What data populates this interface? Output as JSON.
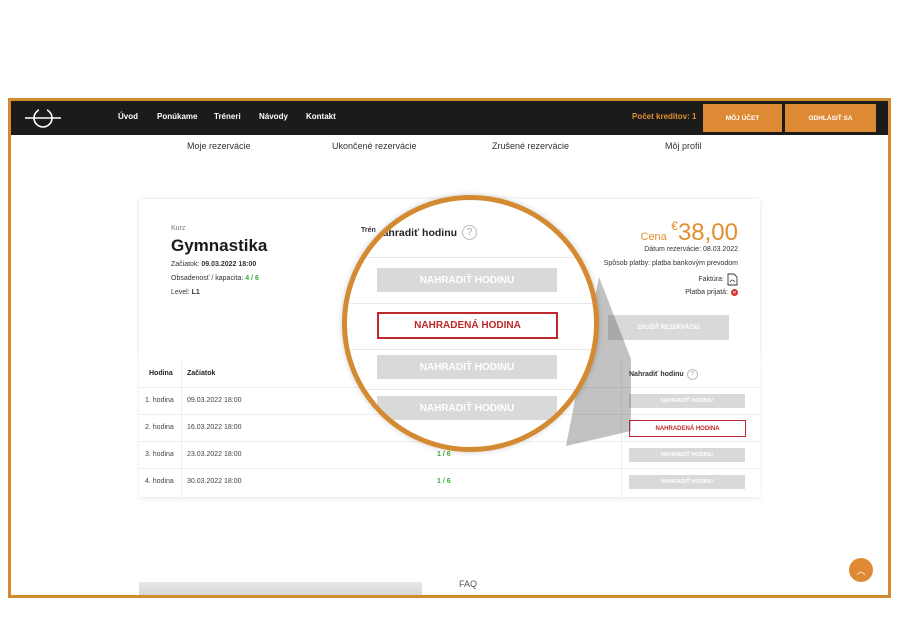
{
  "navbar": {
    "links": [
      "Úvod",
      "Ponúkame",
      "Tréneri",
      "Návody",
      "Kontakt"
    ],
    "credits": "Počet kreditov: 1",
    "account_btn": "MÔJ ÚČET",
    "logout_btn": "ODHLÁSIŤ SA"
  },
  "subnav": [
    "Moje rezervácie",
    "Ukončené rezervácie",
    "Zrušené rezervácie",
    "Môj profil"
  ],
  "course": {
    "label": "Kurz",
    "name": "Gymnastika",
    "start_label": "Začiatok:",
    "start_value": "09.03.2022 18:00",
    "occupancy_label": "Obsadenosť / kapacita:",
    "occupancy_value": "4 / 6",
    "level_label": "Level:",
    "level_value": "L1",
    "trainer_label_partial": "Trén"
  },
  "price": {
    "label": "Cena",
    "currency": "€",
    "value": "38,00",
    "reservation_date": "Dátum rezervácie: 08.03.2022",
    "payment_method": "Spôsob platby: platba bankovým prevodom",
    "invoice": "Faktúra:",
    "payment_received": "Platba prijatá:",
    "cancel_btn": "ZRUŠIŤ REZERVÁCIU"
  },
  "table": {
    "headers": [
      "Hodina",
      "Začiatok",
      "Nahradiť hodinu"
    ],
    "rows": [
      {
        "hour": "1. hodina",
        "start": "09.03.2022 18:00",
        "occ": "",
        "action": "NAHRADIŤ HODINU",
        "replaced": false
      },
      {
        "hour": "2. hodina",
        "start": "16.03.2022 18:00",
        "occ": "",
        "action": "NAHRADENÁ HODINA",
        "replaced": true
      },
      {
        "hour": "3. hodina",
        "start": "23.03.2022 18:00",
        "occ": "1 / 6",
        "action": "NAHRADIŤ HODINU",
        "replaced": false
      },
      {
        "hour": "4. hodina",
        "start": "30.03.2022 18:00",
        "occ": "1 / 6",
        "action": "NAHRADIŤ HODINU",
        "replaced": false
      }
    ]
  },
  "magnifier": {
    "header": "Nahradiť hodinu",
    "buttons": [
      "NAHRADIŤ HODINU",
      "NAHRADENÁ HODINA",
      "NAHRADIŤ HODINU",
      "NAHRADIŤ HODINU"
    ]
  },
  "footer": {
    "faq": "FAQ"
  },
  "colors": {
    "accent": "#de8a35",
    "navbar": "#1b1b1b",
    "green": "#3aa935",
    "red": "#c0292b"
  }
}
